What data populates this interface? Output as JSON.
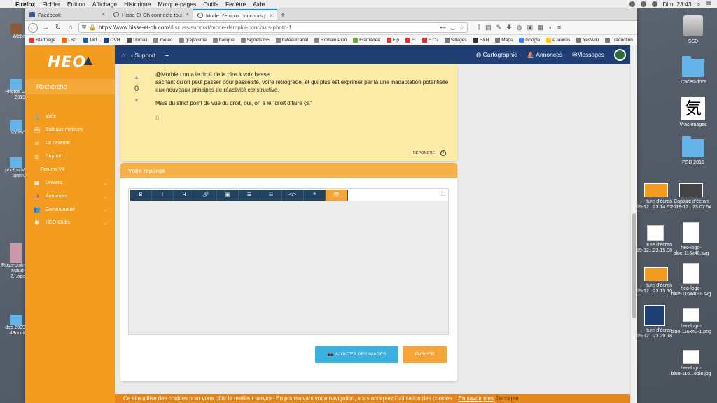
{
  "menubar": {
    "app": "Firefox",
    "items": [
      "Fichier",
      "Édition",
      "Affichage",
      "Historique",
      "Marque-pages",
      "Outils",
      "Fenêtre",
      "Aide"
    ],
    "clock": "Dim. 23:43"
  },
  "tabs": [
    {
      "label": "Facebook",
      "color": "#3b5998"
    },
    {
      "label": "Hisse Et Oh connecte tous les",
      "color": "#555"
    },
    {
      "label": "Mode d'emploi concours photo",
      "color": "#555"
    }
  ],
  "url": {
    "domain": "https://www.hisse-et-oh.com",
    "path": "/discuss/support/mode-demploi-concours-photo-1"
  },
  "bookmarks": [
    {
      "label": "Startpage",
      "color": "#e33"
    },
    {
      "label": "LBC",
      "color": "#f60"
    },
    {
      "label": "1&1",
      "color": "#1a5fb4"
    },
    {
      "label": "OVH",
      "color": "#1a3c8f"
    },
    {
      "label": "18/mail",
      "color": "#555"
    },
    {
      "label": "météo",
      "color": "#888"
    },
    {
      "label": "graphisme",
      "color": "#888"
    },
    {
      "label": "banque",
      "color": "#888"
    },
    {
      "label": "Signets G5",
      "color": "#888"
    },
    {
      "label": "bateau/canal",
      "color": "#888"
    },
    {
      "label": "Romain Pion",
      "color": "#888"
    },
    {
      "label": "Framabee",
      "color": "#6a4"
    },
    {
      "label": "Fip",
      "color": "#d33"
    },
    {
      "label": "FI",
      "color": "#d33"
    },
    {
      "label": "F Cu",
      "color": "#d33"
    },
    {
      "label": "Sillages",
      "color": "#777"
    },
    {
      "label": "H&H",
      "color": "#333"
    },
    {
      "label": "Maps",
      "color": "#777"
    },
    {
      "label": "Google",
      "color": "#4285f4"
    },
    {
      "label": "PJaunes",
      "color": "#fc0"
    },
    {
      "label": "YesWiki",
      "color": "#777"
    },
    {
      "label": "Traduction",
      "color": "#777"
    }
  ],
  "site": {
    "logo": "HEO",
    "search": "Recherche",
    "sidebar": [
      {
        "label": "Voile",
        "icon": "anchor-icon",
        "glyph": "⚓",
        "sub": false,
        "chev": false
      },
      {
        "label": "Bateaux moteurs",
        "icon": "motorboat-icon",
        "glyph": "⛴",
        "sub": false,
        "chev": false
      },
      {
        "label": "La Taverne",
        "icon": "skull-icon",
        "glyph": "☠",
        "sub": false,
        "chev": false
      },
      {
        "label": "Support",
        "icon": "lifebuoy-icon",
        "glyph": "◎",
        "sub": false,
        "chev": false
      },
      {
        "label": "Forums V4",
        "icon": "",
        "glyph": "",
        "sub": true,
        "chev": false
      },
      {
        "label": "Univers",
        "icon": "grid-icon",
        "glyph": "▦",
        "sub": false,
        "chev": true
      },
      {
        "label": "Annonces",
        "icon": "boat-icon",
        "glyph": "⛵",
        "sub": false,
        "chev": true
      },
      {
        "label": "Communauté",
        "icon": "users-icon",
        "glyph": "👥",
        "sub": false,
        "chev": true
      },
      {
        "label": "HEO Clubs",
        "icon": "clubs-icon",
        "glyph": "✱",
        "sub": false,
        "chev": true
      }
    ],
    "topbar": {
      "home": "⌂",
      "back": "Support",
      "plus": "+",
      "right": [
        "Cartographie",
        "Annonces",
        "Messages"
      ]
    },
    "post": {
      "votes": "0",
      "paragraphs": [
        "@Morbleu on a le droit de le dire à voix basse ;\nsachant qu'on peut passer pour passéiste, voire rétrograde, et qui plus est exprimer par là une inadaptation potentielle aux nouveaux principes de réactivité constructive.",
        "Mais du strict point de vue du droit, oui, on a le \"droit d'faire ça\"",
        ":)"
      ],
      "reply": "RÉPONDRE"
    },
    "answer": {
      "title": "Votre réponse",
      "toolbar": [
        "B",
        "I",
        "H",
        "🔗",
        "▣",
        "☰",
        "☷",
        "</>",
        "❝",
        "👁"
      ],
      "add_images": "AJOUTER DES IMAGES",
      "publish": "PUBLIER"
    },
    "cookie": {
      "text": "Ce site utilise des cookies pour vous offrir le meilleur service. En poursuivant votre navigation, vous acceptez l'utilisation des cookies.",
      "link": "En savoir plus",
      "accept": "J'accepte"
    }
  },
  "desktop": {
    "right": [
      {
        "label": "SSD",
        "kind": "hdd"
      },
      {
        "label": "Traces-docs",
        "kind": "folder"
      },
      {
        "label": "Vrac-images",
        "kind": "kanji"
      },
      {
        "label": "PSD 2019",
        "kind": "folder"
      },
      {
        "label": "Capture d'écran\n2019-12...23.07.54",
        "kind": "thumb"
      },
      {
        "label": "heo-logo-\nblue-116x40.svg",
        "kind": "doc"
      },
      {
        "label": "heo-logo-\nblue-116x40-1.svg",
        "kind": "doc"
      },
      {
        "label": "heo-logo-\nblue-116x40-1.png",
        "kind": "doc"
      },
      {
        "label": "heo-logo-\nblue-116...opie.jpg",
        "kind": "doc"
      }
    ],
    "middle": [
      {
        "label": "ture d'écran\n2019-12...23.14.57"
      },
      {
        "label": "ture d'écran\n2019-12...23.15.08"
      },
      {
        "label": "ture d'écran\n2019-12...23.15.10"
      },
      {
        "label": "ture d'écran\n2019-12...23.20.18"
      }
    ],
    "left": [
      {
        "label": "Atelie"
      },
      {
        "label": "Photos C\n2019"
      },
      {
        "label": "NX250"
      },
      {
        "label": "photos M\nanniv"
      },
      {
        "label": "Rose-pink-\nMaud-2...ope"
      },
      {
        "label": "dec 2009\n43occit"
      }
    ],
    "kanji": "気"
  }
}
